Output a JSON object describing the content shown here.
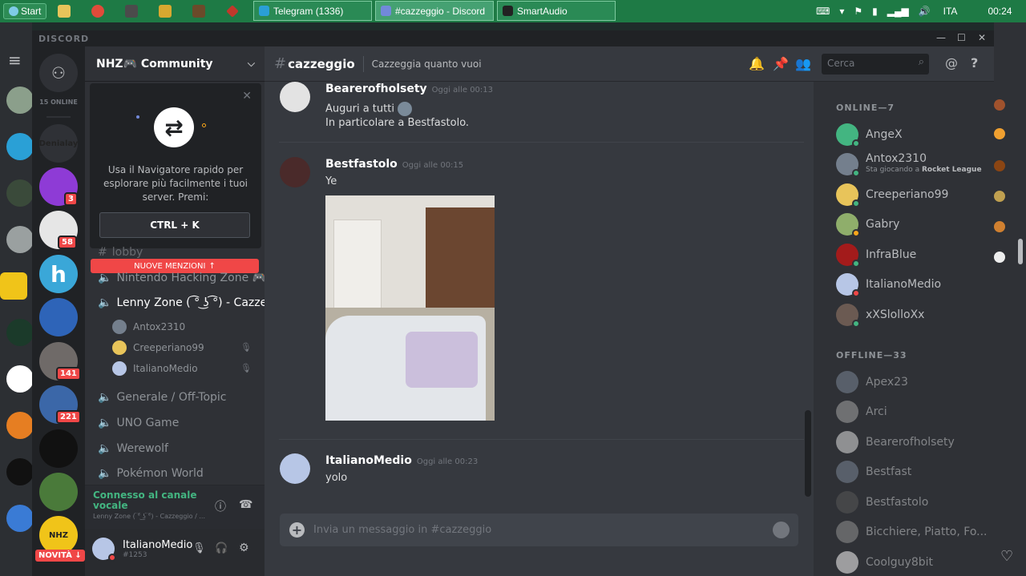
{
  "taskbar": {
    "start_label": "Start",
    "windows": [
      {
        "label": "Telegram (1336)",
        "icon": "telegram-icon"
      },
      {
        "label": "#cazzeggio - Discord",
        "icon": "discord-icon",
        "active": true
      },
      {
        "label": "SmartAudio",
        "icon": "smartaudio-icon"
      }
    ],
    "language": "ITA",
    "time": "00:24"
  },
  "discord": {
    "window_title": "DISCORD",
    "online_count": "15 ONLINE",
    "server_name": "NHZ🎮 Community",
    "guilds": [
      {
        "name": "Denialay",
        "label": "Denialay",
        "color": "#2f3136"
      },
      {
        "name": "guild-purple",
        "badge": "3",
        "color": "#8e3bd6"
      },
      {
        "name": "guild-manga",
        "badge": "58",
        "color": "#e6e6e6"
      },
      {
        "name": "guild-h",
        "label": "h",
        "color": "#3aa7d8"
      },
      {
        "name": "guild-blue-mascot",
        "color": "#2e64b8"
      },
      {
        "name": "guild-anime",
        "badge": "141",
        "color": "#6f6a68"
      },
      {
        "name": "guild-dark",
        "badge": "221",
        "color": "#3b67a8"
      },
      {
        "name": "guild-godfather",
        "color": "#111111"
      },
      {
        "name": "guild-minecraft",
        "color": "#4a7a3a"
      },
      {
        "name": "guild-nhz",
        "label": "NHZ",
        "color": "#f0c419"
      }
    ],
    "new_badge": "NOVITÀ",
    "quick_switcher": {
      "text": "Usa il Navigatore rapido per esplorare più facilmente i tuoi server. Premi:",
      "shortcut": "CTRL + K"
    },
    "mentions_bar": "NUOVE MENZIONI",
    "channels": [
      {
        "name": "lobby"
      },
      {
        "name": "Nintendo Hacking Zone 🎮..."
      },
      {
        "name": "Lenny Zone ( ͡° ͜ʖ ͡°) - Cazze...",
        "active": true
      },
      {
        "name": "Generale / Off-Topic"
      },
      {
        "name": "UNO Game"
      },
      {
        "name": "Werewolf"
      },
      {
        "name": "Pokémon World"
      }
    ],
    "voice_users": [
      {
        "name": "Antox2310",
        "color": "#747f8d"
      },
      {
        "name": "Creeperiano99",
        "color": "#e8c45a"
      },
      {
        "name": "ItalianoMedio",
        "color": "#b7c6e6"
      }
    ],
    "voice_status": {
      "title": "Connesso al canale vocale",
      "sub": "Lenny Zone ( ͡° ͜ʖ ͡°) - Cazzeggio / ..."
    },
    "user": {
      "name": "ItalianoMedio",
      "tag": "#1253"
    },
    "chat": {
      "channel": "cazzeggio",
      "topic": "Cazzeggia quanto vuoi",
      "search_placeholder": "Cerca",
      "messages": [
        {
          "author": "Bearerofholsety",
          "time": "Oggi alle 00:13",
          "lines": [
            "Auguri a tutti",
            "In particolare a Bestfastolo."
          ]
        },
        {
          "author": "Bestfastolo",
          "time": "Oggi alle 00:15",
          "lines": [
            "Ye"
          ]
        },
        {
          "author": "ItalianoMedio",
          "time": "Oggi alle 00:23",
          "lines": [
            "yolo"
          ]
        }
      ],
      "input_placeholder": "Invia un messaggio in #cazzeggio"
    },
    "members": {
      "online_header": "ONLINE—7",
      "offline_header": "OFFLINE—33",
      "online": [
        {
          "name": "AngeX",
          "status": "#43b581",
          "color": "#43b581"
        },
        {
          "name": "Antox2310",
          "status": "#43b581",
          "color": "#747f8d",
          "activity_prefix": "Sta giocando a ",
          "activity": "Rocket League"
        },
        {
          "name": "Creeperiano99",
          "status": "#43b581",
          "color": "#e8c45a"
        },
        {
          "name": "Gabry",
          "status": "#faa61a",
          "color": "#8fae6b"
        },
        {
          "name": "InfraBlue",
          "status": "#43b581",
          "color": "#a31b1b"
        },
        {
          "name": "ItalianoMedio",
          "status": "#f04747",
          "color": "#b7c6e6"
        },
        {
          "name": "xXSlolloXx",
          "status": "#43b581",
          "color": "#6b5a52"
        }
      ],
      "offline": [
        {
          "name": "Apex23",
          "color": "#747f8d"
        },
        {
          "name": "Arci",
          "color": "#9a9a9a"
        },
        {
          "name": "Bearerofholsety",
          "color": "#cfcfcf"
        },
        {
          "name": "Bestfast",
          "color": "#747f8d"
        },
        {
          "name": "Bestfastolo",
          "color": "#555555"
        },
        {
          "name": "Bicchiere, Piatto, Fo...",
          "color": "#8a8a8a"
        },
        {
          "name": "Coolguy8bit",
          "color": "#e6e6e6"
        }
      ]
    },
    "colors": {
      "accent": "#7289da",
      "online": "#43b581",
      "mention": "#f04747"
    }
  }
}
